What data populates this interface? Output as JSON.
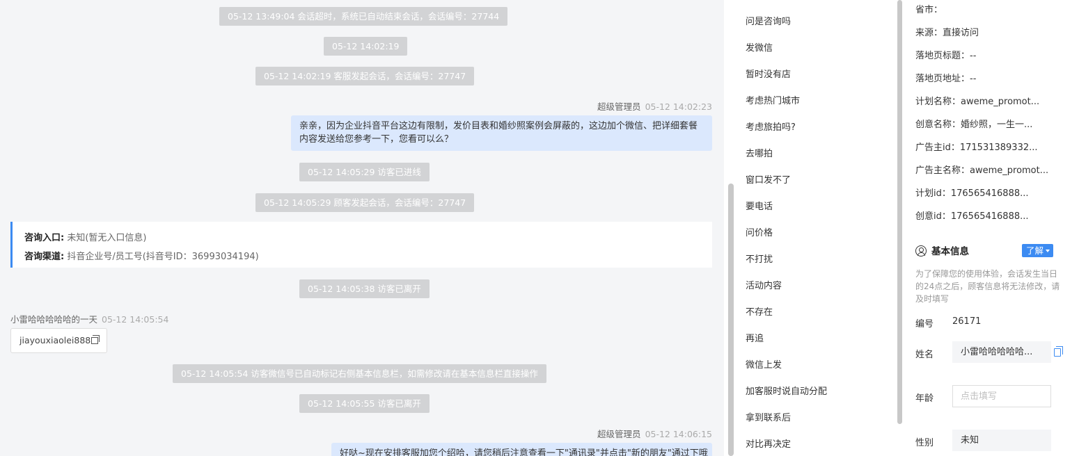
{
  "chat": {
    "system_messages": [
      "05-12 13:49:04 会话超时，系统已自动结束会话，会话编号：27744",
      "05-12 14:02:19",
      "05-12 14:02:19 客服发起会话，会话编号：27747",
      "05-12 14:05:29 访客已进线",
      "05-12 14:05:29 顾客发起会话，会话编号：27747",
      "05-12 14:05:38 访客已离开",
      "05-12 14:05:54 访客微信号已自动标记右侧基本信息栏，如需修改请在基本信息栏直接操作",
      "05-12 14:05:55 访客已离开"
    ],
    "agent_msg_1": {
      "sender": "超级管理员",
      "time": "05-12 14:02:23",
      "line1": "亲亲，因为企业抖音平台这边有限制，发价目表和婚纱照案例会屏蔽的，这边加个微信、把详细套餐",
      "line2": "内容发送给您参考一下，您看可以么？"
    },
    "consult_card": {
      "entry_label": "咨询入口:",
      "entry_value": "未知(暂无入口信息)",
      "channel_label": "咨询渠道:",
      "channel_value": "抖音企业号/员工号(抖音号ID：36993034194)"
    },
    "visitor_msg": {
      "sender": "小雷哈哈哈哈哈的一天",
      "time": "05-12 14:05:54",
      "text": "jiayouxiaolei888"
    },
    "agent_msg_2": {
      "sender": "超级管理员",
      "time": "05-12 14:06:15",
      "text": "好哒~现在安排客服加您个绍哈，请您稍后注意查看一下\"通讯录\"并点击\"新的朋友\"通过下哦"
    }
  },
  "quick_replies": [
    "问是咨询吗",
    "发微信",
    "暂时没有店",
    "考虑热门城市",
    "考虑旅拍吗?",
    "去哪拍",
    "窗口发不了",
    "要电话",
    "问价格",
    "不打扰",
    "活动内容",
    "不存在",
    "再追",
    "微信上发",
    "加客服时说自动分配",
    "拿到联系后",
    "对比再决定"
  ],
  "visitor_fields": [
    "省市：",
    "来源：直接访问",
    "落地页标题：--",
    "落地页地址：--",
    "计划名称：aweme_promot...",
    "创意名称：婚纱照，一生一...",
    "广告主id：171531389332...",
    "广告主名称：aweme_promot...",
    "计划id：176565416888...",
    "创意id：176565416888..."
  ],
  "basic_info": {
    "title": "基本信息",
    "learn_label": "了解",
    "note": "为了保障您的使用体验，会话发生当日的24点之后，顾客信息将无法修改，请及时填写",
    "id_label": "编号",
    "id_value": "26171",
    "name_label": "姓名",
    "name_value": "小雷哈哈哈哈哈...",
    "age_label": "年龄",
    "age_placeholder": "点击填写",
    "gender_label": "性别",
    "gender_value": "未知"
  },
  "colors": {
    "accent": "#3c8bf2",
    "bubble": "#dbe8fd",
    "system_pill": "#d2d3d5",
    "chat_bg": "#f4f5f7"
  }
}
